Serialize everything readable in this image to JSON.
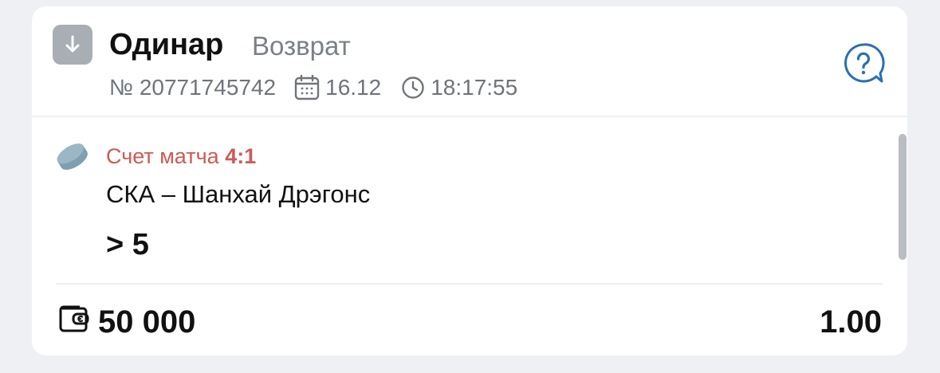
{
  "bet": {
    "type_label": "Одинар",
    "status_label": "Возврат",
    "number": "№ 20771745742",
    "date": "16.12",
    "time": "18:17:55"
  },
  "event": {
    "score_prefix": "Счет матча",
    "score_value": "4:1",
    "match_name": "СКА – Шанхай Дрэгонс",
    "selection": "> 5"
  },
  "footer": {
    "stake": "50 000",
    "odds": "1.00"
  },
  "icons": {
    "type_badge": "arrow-down-icon",
    "date": "calendar-icon",
    "time": "clock-icon",
    "help": "question-bubble-icon",
    "sport": "hockey-puck-icon",
    "stake": "wallet-icon"
  },
  "colors": {
    "score_accent": "#cd5a54",
    "help_accent": "#2a6fb3",
    "badge_bg": "#a9aeb5",
    "text_primary": "#111111",
    "text_secondary": "#6f747b"
  }
}
